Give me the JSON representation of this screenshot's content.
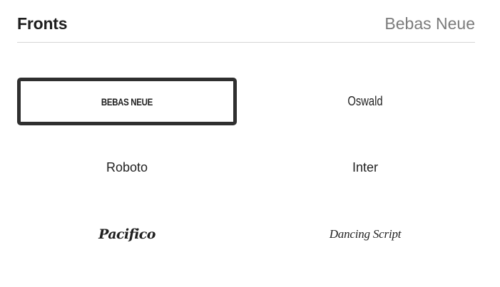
{
  "header": {
    "title": "Fronts",
    "selected_font": "Bebas Neue"
  },
  "fonts": [
    {
      "label": "BEBAS NEUE",
      "selected": true
    },
    {
      "label": "Oswald",
      "selected": false
    },
    {
      "label": "Roboto",
      "selected": false
    },
    {
      "label": "Inter",
      "selected": false
    },
    {
      "label": "Pacifico",
      "selected": false
    },
    {
      "label": "Dancing Script",
      "selected": false
    }
  ],
  "colors": {
    "selected_border": "#2f2f2f",
    "divider": "#d6d6d6",
    "muted_text": "#7b7b7b"
  }
}
